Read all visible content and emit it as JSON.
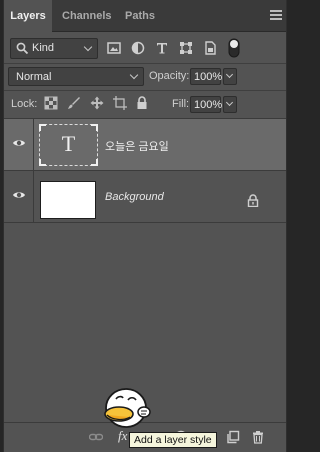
{
  "tabs": [
    {
      "label": "Layers",
      "active": true
    },
    {
      "label": "Channels",
      "active": false
    },
    {
      "label": "Paths",
      "active": false
    }
  ],
  "filter": {
    "kind_label": "Kind",
    "icons": [
      "image-filter-icon",
      "adjustment-filter-icon",
      "type-filter-icon",
      "shape-filter-icon",
      "smart-object-filter-icon",
      "filter-toggle-icon"
    ]
  },
  "blend": {
    "mode": "Normal",
    "opacity_label": "Opacity:",
    "opacity_value": "100%"
  },
  "lock": {
    "label": "Lock:",
    "icons": [
      "lock-transparent-pixels-icon",
      "lock-image-pixels-icon",
      "lock-position-icon",
      "lock-artboard-icon",
      "lock-all-icon"
    ],
    "fill_label": "Fill:",
    "fill_value": "100%"
  },
  "layers": [
    {
      "name": "오늘은 금요일",
      "type": "text",
      "thumb_glyph": "T",
      "visible": true,
      "selected": true
    },
    {
      "name": "Background",
      "type": "background",
      "visible": true,
      "selected": false,
      "locked": true
    }
  ],
  "bottom": {
    "icons": [
      "link-layers-icon",
      "fx-icon",
      "add-mask-icon",
      "adjustment-layer-icon",
      "group-icon",
      "new-layer-icon",
      "delete-layer-icon"
    ],
    "fx_label": "fx",
    "tooltip": "Add a layer style"
  },
  "colors": {
    "panel": "#535353",
    "selected_row": "#6a6a6a",
    "tabbar": "#3a3a3a",
    "tooltip_bg": "#f5f5dc"
  }
}
